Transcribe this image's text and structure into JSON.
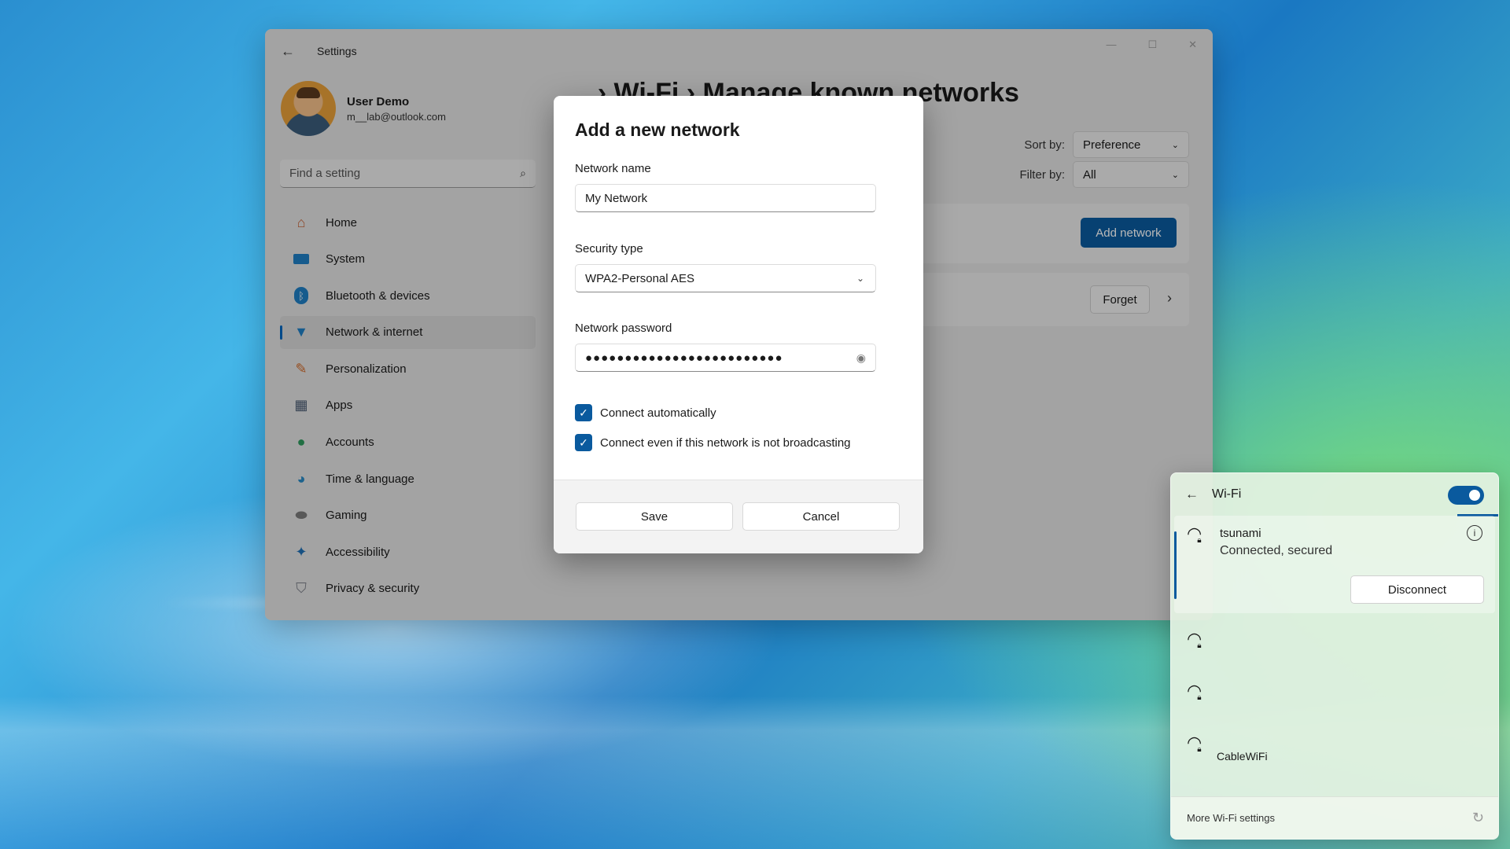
{
  "settings": {
    "app_title": "Settings",
    "profile": {
      "name": "User Demo",
      "email": "m__lab@outlook.com"
    },
    "search": {
      "placeholder": "Find a setting"
    },
    "nav": [
      {
        "label": "Home",
        "icon": "home-icon"
      },
      {
        "label": "System",
        "icon": "system-icon"
      },
      {
        "label": "Bluetooth & devices",
        "icon": "bluetooth-icon"
      },
      {
        "label": "Network & internet",
        "icon": "network-icon",
        "active": true
      },
      {
        "label": "Personalization",
        "icon": "brush-icon"
      },
      {
        "label": "Apps",
        "icon": "apps-icon"
      },
      {
        "label": "Accounts",
        "icon": "accounts-icon"
      },
      {
        "label": "Time & language",
        "icon": "globe-icon"
      },
      {
        "label": "Gaming",
        "icon": "gamepad-icon"
      },
      {
        "label": "Accessibility",
        "icon": "accessibility-icon"
      },
      {
        "label": "Privacy & security",
        "icon": "shield-icon"
      }
    ],
    "page_title": "... › Wi-Fi › Manage known networks",
    "sort_by": {
      "label": "Sort by:",
      "value": "Preference"
    },
    "filter_by": {
      "label": "Filter by:",
      "value": "All"
    },
    "add_network_label": "Add network",
    "forget_label": "Forget"
  },
  "dialog": {
    "title": "Add a new network",
    "network_name": {
      "label": "Network name",
      "value": "My Network"
    },
    "security_type": {
      "label": "Security type",
      "value": "WPA2-Personal AES"
    },
    "network_password": {
      "label": "Network password",
      "value": "●●●●●●●●●●●●●●●●●●●●●●●●●"
    },
    "connect_auto": {
      "label": "Connect automatically",
      "checked": true
    },
    "connect_hidden": {
      "label": "Connect even if this network is not broadcasting",
      "checked": true
    },
    "save_label": "Save",
    "cancel_label": "Cancel"
  },
  "wifi_flyout": {
    "title": "Wi-Fi",
    "toggle_on": true,
    "connected": {
      "name": "tsunami",
      "status": "Connected, secured",
      "disconnect_label": "Disconnect"
    },
    "partial_network": "CableWiFi",
    "more_link": "More Wi-Fi settings"
  },
  "colors": {
    "accent": "#0a5a9e"
  }
}
